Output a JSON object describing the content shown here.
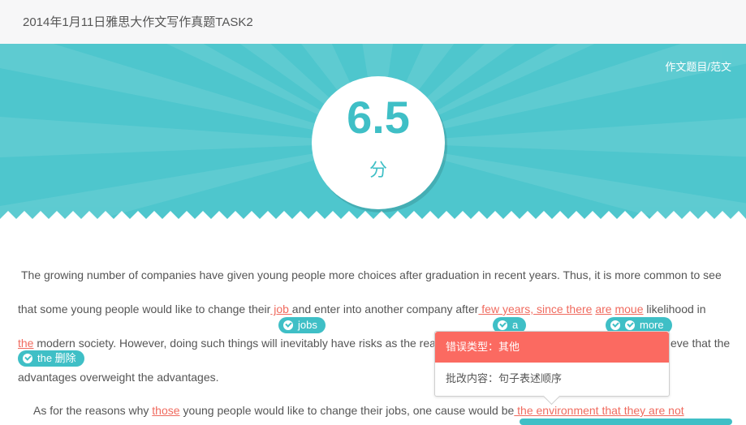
{
  "header": {
    "title": "2014年1月11日雅思大作文写作真题TASK2"
  },
  "banner": {
    "essay_link": "作文题目/范文",
    "score": "6.5",
    "score_unit": "分",
    "colors": {
      "teal": "#4ec6cd",
      "score_text": "#3fbfc6"
    }
  },
  "essay": {
    "line1": "The growing number of companies have given young people more choices after graduation in recent years. Thus, it is more common to see",
    "line2": {
      "a": "that some young people would like to change their",
      "err_job": " job ",
      "b": "and enter into another company after",
      "err_few": " few years, since there",
      "err_are": "are",
      "err_moue": "moue",
      "c": "likelihood in"
    },
    "line3": {
      "err_the": "the",
      "a": "modern society. However, doing such things will inevitably have risks as the rea",
      "b": "eve that the"
    },
    "line4": "advantages overweight the advantages.",
    "line5": {
      "a": "As for the reasons why",
      "err_those": "those",
      "b": "young people would like to change their jobs, one cause would be",
      "err_env": " the environment that they are not"
    },
    "chips": {
      "jobs": "jobs",
      "a": "a",
      "more": "more",
      "the_delete": "the 删除"
    }
  },
  "tooltip": {
    "error_type_label": "错误类型：其他",
    "correction_label": "批改内容：句子表述顺序",
    "colors": {
      "header_bg": "#fb6a61"
    }
  }
}
